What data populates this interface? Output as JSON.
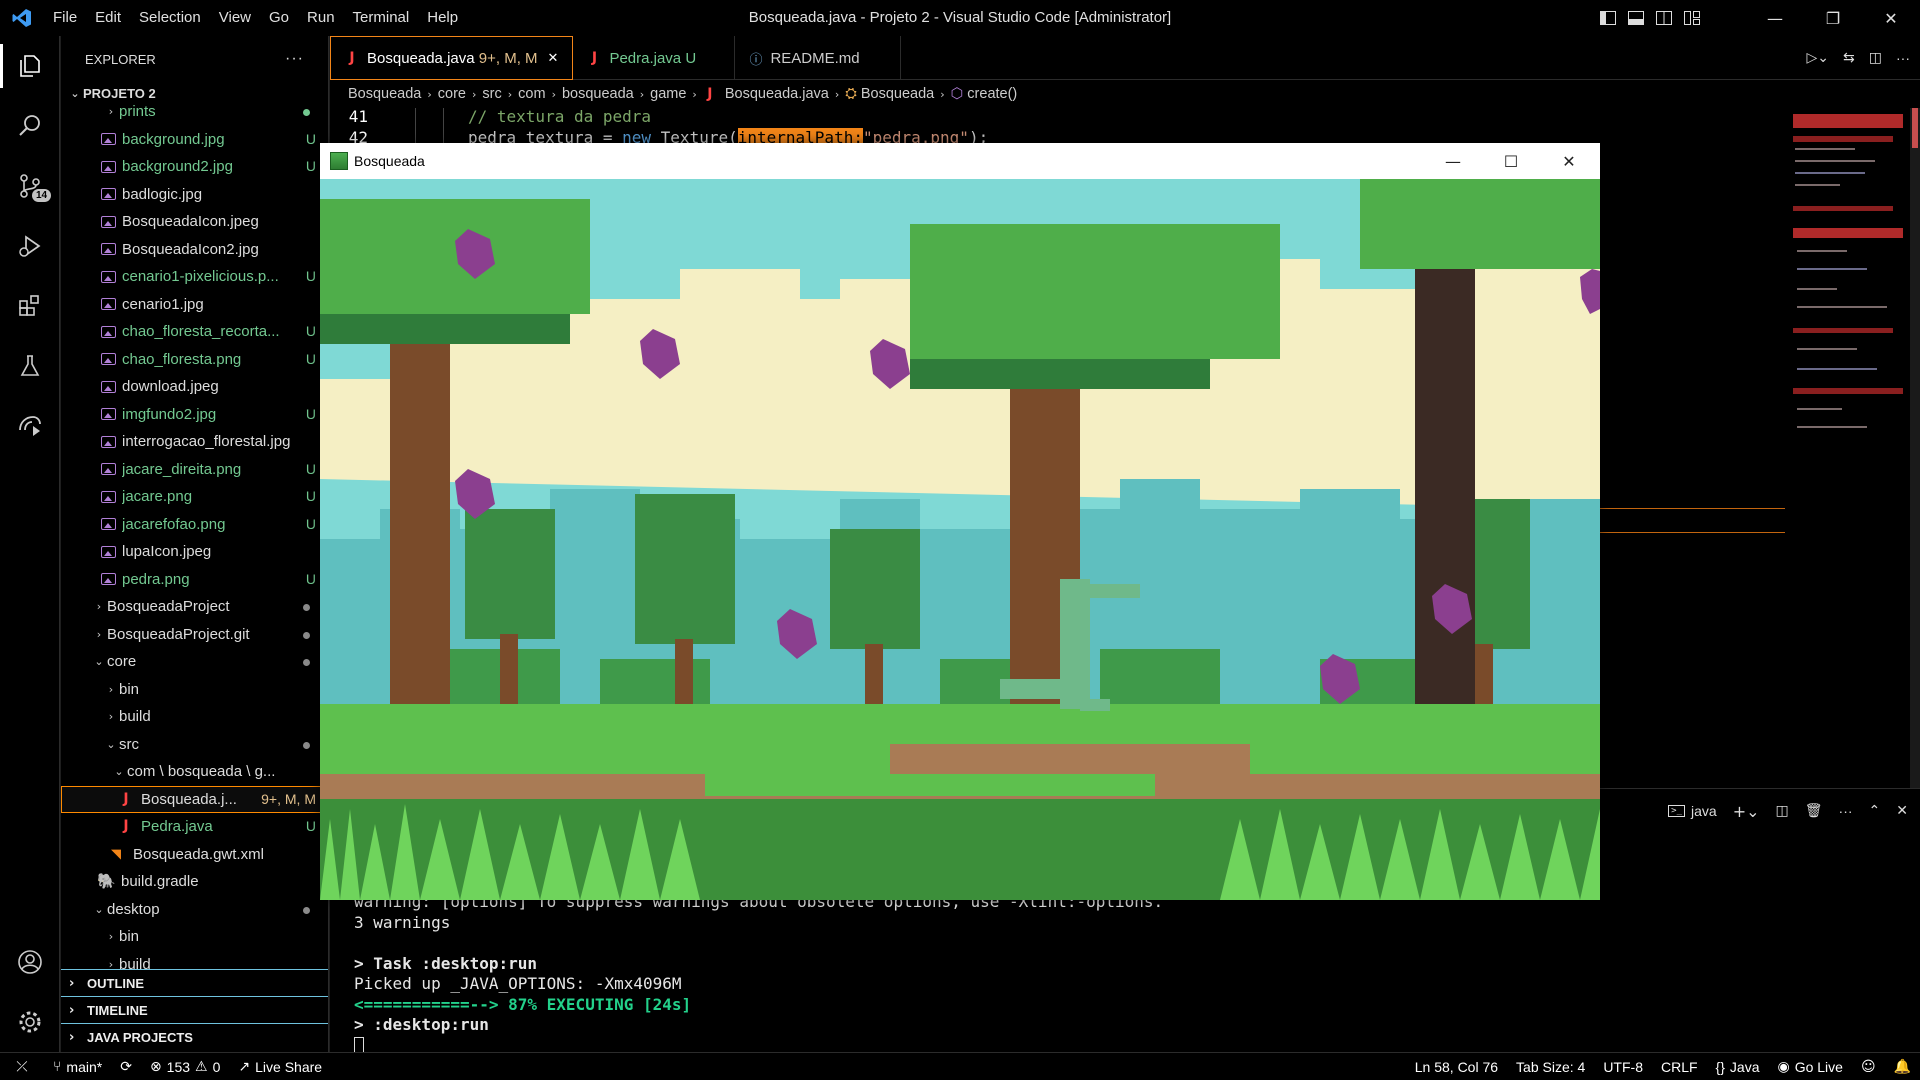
{
  "titlebar": {
    "menu": [
      "File",
      "Edit",
      "Selection",
      "View",
      "Go",
      "Run",
      "Terminal",
      "Help"
    ],
    "window_title": "Bosqueada.java - Projeto 2 - Visual Studio Code [Administrator]"
  },
  "activity": {
    "source_control_badge": "14"
  },
  "sidebar": {
    "header": "EXPLORER",
    "project": "PROJETO 2",
    "rows": [
      {
        "label": "prints",
        "status": ""
      },
      {
        "label": "background.jpg",
        "status": "U"
      },
      {
        "label": "background2.jpg",
        "status": "U"
      },
      {
        "label": "badlogic.jpg",
        "status": ""
      },
      {
        "label": "BosqueadaIcon.jpeg",
        "status": ""
      },
      {
        "label": "BosqueadaIcon2.jpg",
        "status": ""
      },
      {
        "label": "cenario1-pixelicious.p...",
        "status": "U"
      },
      {
        "label": "cenario1.jpg",
        "status": ""
      },
      {
        "label": "chao_floresta_recorta...",
        "status": "U"
      },
      {
        "label": "chao_floresta.png",
        "status": "U"
      },
      {
        "label": "download.jpeg",
        "status": ""
      },
      {
        "label": "imgfundo2.jpg",
        "status": "U"
      },
      {
        "label": "interrogacao_florestal.jpg",
        "status": ""
      },
      {
        "label": "jacare_direita.png",
        "status": "U"
      },
      {
        "label": "jacare.png",
        "status": "U"
      },
      {
        "label": "jacarefofao.png",
        "status": "U"
      },
      {
        "label": "lupaIcon.jpeg",
        "status": ""
      },
      {
        "label": "pedra.png",
        "status": "U"
      },
      {
        "label": "BosqueadaProject",
        "status": ""
      },
      {
        "label": "BosqueadaProject.git",
        "status": ""
      },
      {
        "label": "core",
        "status": ""
      },
      {
        "label": "bin",
        "status": ""
      },
      {
        "label": "build",
        "status": ""
      },
      {
        "label": "src",
        "status": ""
      },
      {
        "label": "com \\ bosqueada \\ g...",
        "status": ""
      },
      {
        "label": "Bosqueada.j...",
        "status": "9+, M, M"
      },
      {
        "label": "Pedra.java",
        "status": "U"
      },
      {
        "label": "Bosqueada.gwt.xml",
        "status": ""
      },
      {
        "label": "build.gradle",
        "status": ""
      },
      {
        "label": "desktop",
        "status": ""
      },
      {
        "label": "bin",
        "status": ""
      },
      {
        "label": "build",
        "status": ""
      }
    ],
    "sections": [
      "OUTLINE",
      "TIMELINE",
      "JAVA PROJECTS"
    ]
  },
  "tabs": [
    {
      "label": "Bosqueada.java",
      "status": "9+, M, M"
    },
    {
      "label": "Pedra.java",
      "status": "U"
    },
    {
      "label": "README.md",
      "status": ""
    }
  ],
  "breadcrumb": [
    "Bosqueada",
    "core",
    "src",
    "com",
    "bosqueada",
    "game",
    "Bosqueada.java",
    "Bosqueada",
    "create()"
  ],
  "code": {
    "line41_no": "41",
    "line41_text": "// textura da pedra",
    "line42_no": "42",
    "line42_a": "pedra_textura = ",
    "line42_kw": "new",
    "line42_b": " Texture(",
    "line42_hint": "internalPath:",
    "line42_str": "\"pedra.png\"",
    "line42_end": ");"
  },
  "panel": {
    "terminal_label": "java"
  },
  "terminal": [
    "warning: [options] To suppress warnings about obsolete options, use -Xlint:-options.",
    "3 warnings",
    "",
    "> Task :desktop:run",
    "Picked up _JAVA_OPTIONS: -Xmx4096M",
    "<===========--> 87% EXECUTING [24s]",
    "> :desktop:run"
  ],
  "statusbar": {
    "branch": "main*",
    "errors": "153",
    "warnings": "0",
    "live_share": "Live Share",
    "position": "Ln 58, Col 76",
    "tab_size": "Tab Size: 4",
    "encoding": "UTF-8",
    "eol": "CRLF",
    "language": "Java",
    "go_live": "Go Live"
  },
  "game_window": {
    "title": "Bosqueada",
    "scene": {
      "sky": "#7fd9d5",
      "cloud": "#f5efc4",
      "hills": "#5fbfbf",
      "foliage": "#3f9a4a",
      "ground": "#a97b55",
      "grass": "#5ec04e",
      "crystal": "#8b3f8f"
    }
  }
}
